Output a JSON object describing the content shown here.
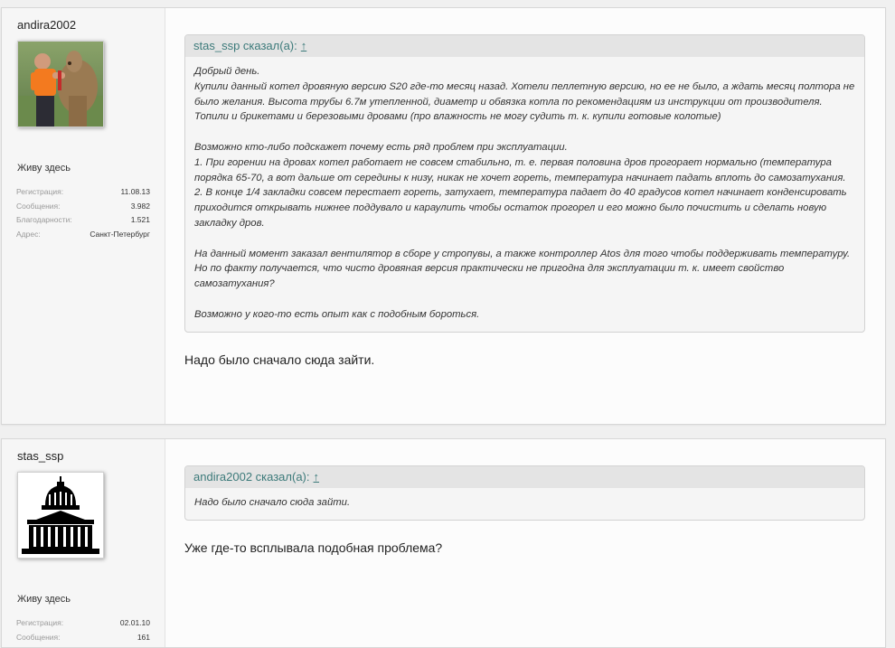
{
  "posts": [
    {
      "username": "andira2002",
      "user_title": "Живу здесь",
      "stats": [
        {
          "label": "Регистрация:",
          "value": "11.08.13"
        },
        {
          "label": "Сообщения:",
          "value": "3.982"
        },
        {
          "label": "Благодарности:",
          "value": "1.521"
        },
        {
          "label": "Адрес:",
          "value": "Санкт-Петербург"
        }
      ],
      "quote": {
        "author": "stas_ssp сказал(а):",
        "arrow": "↑",
        "lines": [
          "Добрый день.",
          "Купили данный котел дровяную версию S20 где-то месяц назад. Хотели пеллетную версию, но ее не было, а ждать месяц полтора не было желания. Высота трубы 6.7м утепленной, диаметр и обвязка котла по рекомендациям из инструкции от производителя. Топили и брикетами и березовыми дровами (про влажность не могу судить т. к. купили готовые колотые)",
          "",
          "Возможно кто-либо подскажет почему есть ряд проблем при эксплуатации.",
          "1. При горении на дровах котел работает не совсем стабильно, т. е. первая половина дров прогорает нормально (температура порядка 65-70, а вот дальше от середины к низу, никак не хочет гореть, температура начинает падать вплоть до самозатухания.",
          "2. В конце 1/4 закладки совсем перестает гореть, затухает, температура падает до 40 градусов котел начинает конденсировать приходится открывать нижнее поддувало и караулить чтобы остаток прогорел и его можно было почистить и сделать новую закладку дров.",
          "",
          "На данный момент заказал вентилятор в сборе у стропувы, а также контроллер Atos для того чтобы поддерживать температуру. Но по факту получается, что чисто дровяная версия практически не пригодна для эксплуатации т. к. имеет свойство самозатухания?",
          "",
          "Возможно у кого-то есть опыт как с подобным бороться."
        ]
      },
      "message": "Надо было сначало сюда зайти."
    },
    {
      "username": "stas_ssp",
      "user_title": "Живу здесь",
      "stats": [
        {
          "label": "Регистрация:",
          "value": "02.01.10"
        },
        {
          "label": "Сообщения:",
          "value": "161"
        }
      ],
      "quote": {
        "author": "andira2002 сказал(а):",
        "arrow": "↑",
        "lines": [
          "Надо было сначало сюда зайти."
        ]
      },
      "message": "Уже где-то всплывала подобная проблема?"
    }
  ],
  "colors": {
    "quote_author": "#3c7a7a",
    "page_background": "#f0f0f0",
    "sidebar_background": "#f6f6f6"
  }
}
